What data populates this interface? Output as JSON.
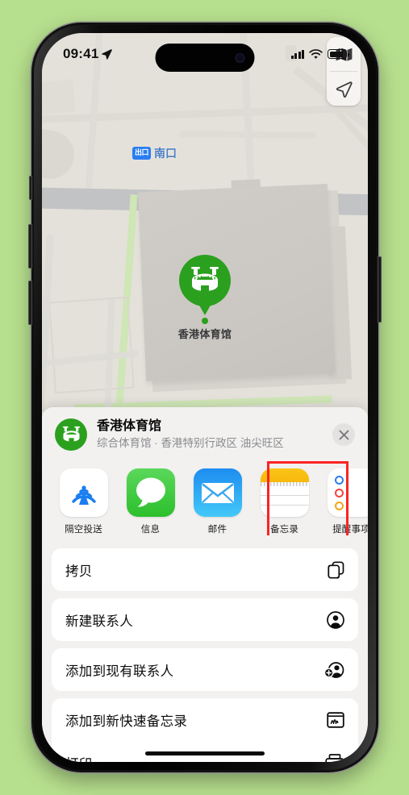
{
  "status_bar": {
    "time": "09:41",
    "location_arrow": "location-arrow-icon",
    "signal": "cellular-bars-icon",
    "wifi": "wifi-icon",
    "battery": "battery-icon"
  },
  "map": {
    "transit_exit_badge": "出口",
    "transit_exit_name": "南口",
    "pin_label": "香港体育馆",
    "pin_color": "#2ba01f",
    "controls": [
      {
        "name": "map-type-button",
        "icon": "folded-map-icon"
      },
      {
        "name": "locate-me-button",
        "icon": "navigation-arrow-icon"
      }
    ]
  },
  "share_sheet": {
    "title": "香港体育馆",
    "subtitle": "综合体育馆 · 香港特别行政区 油尖旺区",
    "close_label": "✕",
    "apps": [
      {
        "label": "隔空投送",
        "icon": "airdrop-icon",
        "highlighted": false
      },
      {
        "label": "信息",
        "icon": "messages-icon",
        "highlighted": false
      },
      {
        "label": "邮件",
        "icon": "mail-icon",
        "highlighted": false
      },
      {
        "label": "备忘录",
        "icon": "notes-icon",
        "highlighted": true
      },
      {
        "label": "提醒事项",
        "icon": "reminders-icon",
        "highlighted": false
      }
    ],
    "highlight_color": "#fb2323",
    "actions": [
      {
        "label": "拷贝",
        "icon": "copy-icon"
      },
      {
        "label": "新建联系人",
        "icon": "person-circle-icon"
      },
      {
        "label": "添加到现有联系人",
        "icon": "person-add-icon"
      },
      {
        "label": "添加到新快速备忘录",
        "icon": "quick-note-icon"
      },
      {
        "label": "打印",
        "icon": "printer-icon"
      }
    ]
  },
  "background_color": "#b7e08e"
}
